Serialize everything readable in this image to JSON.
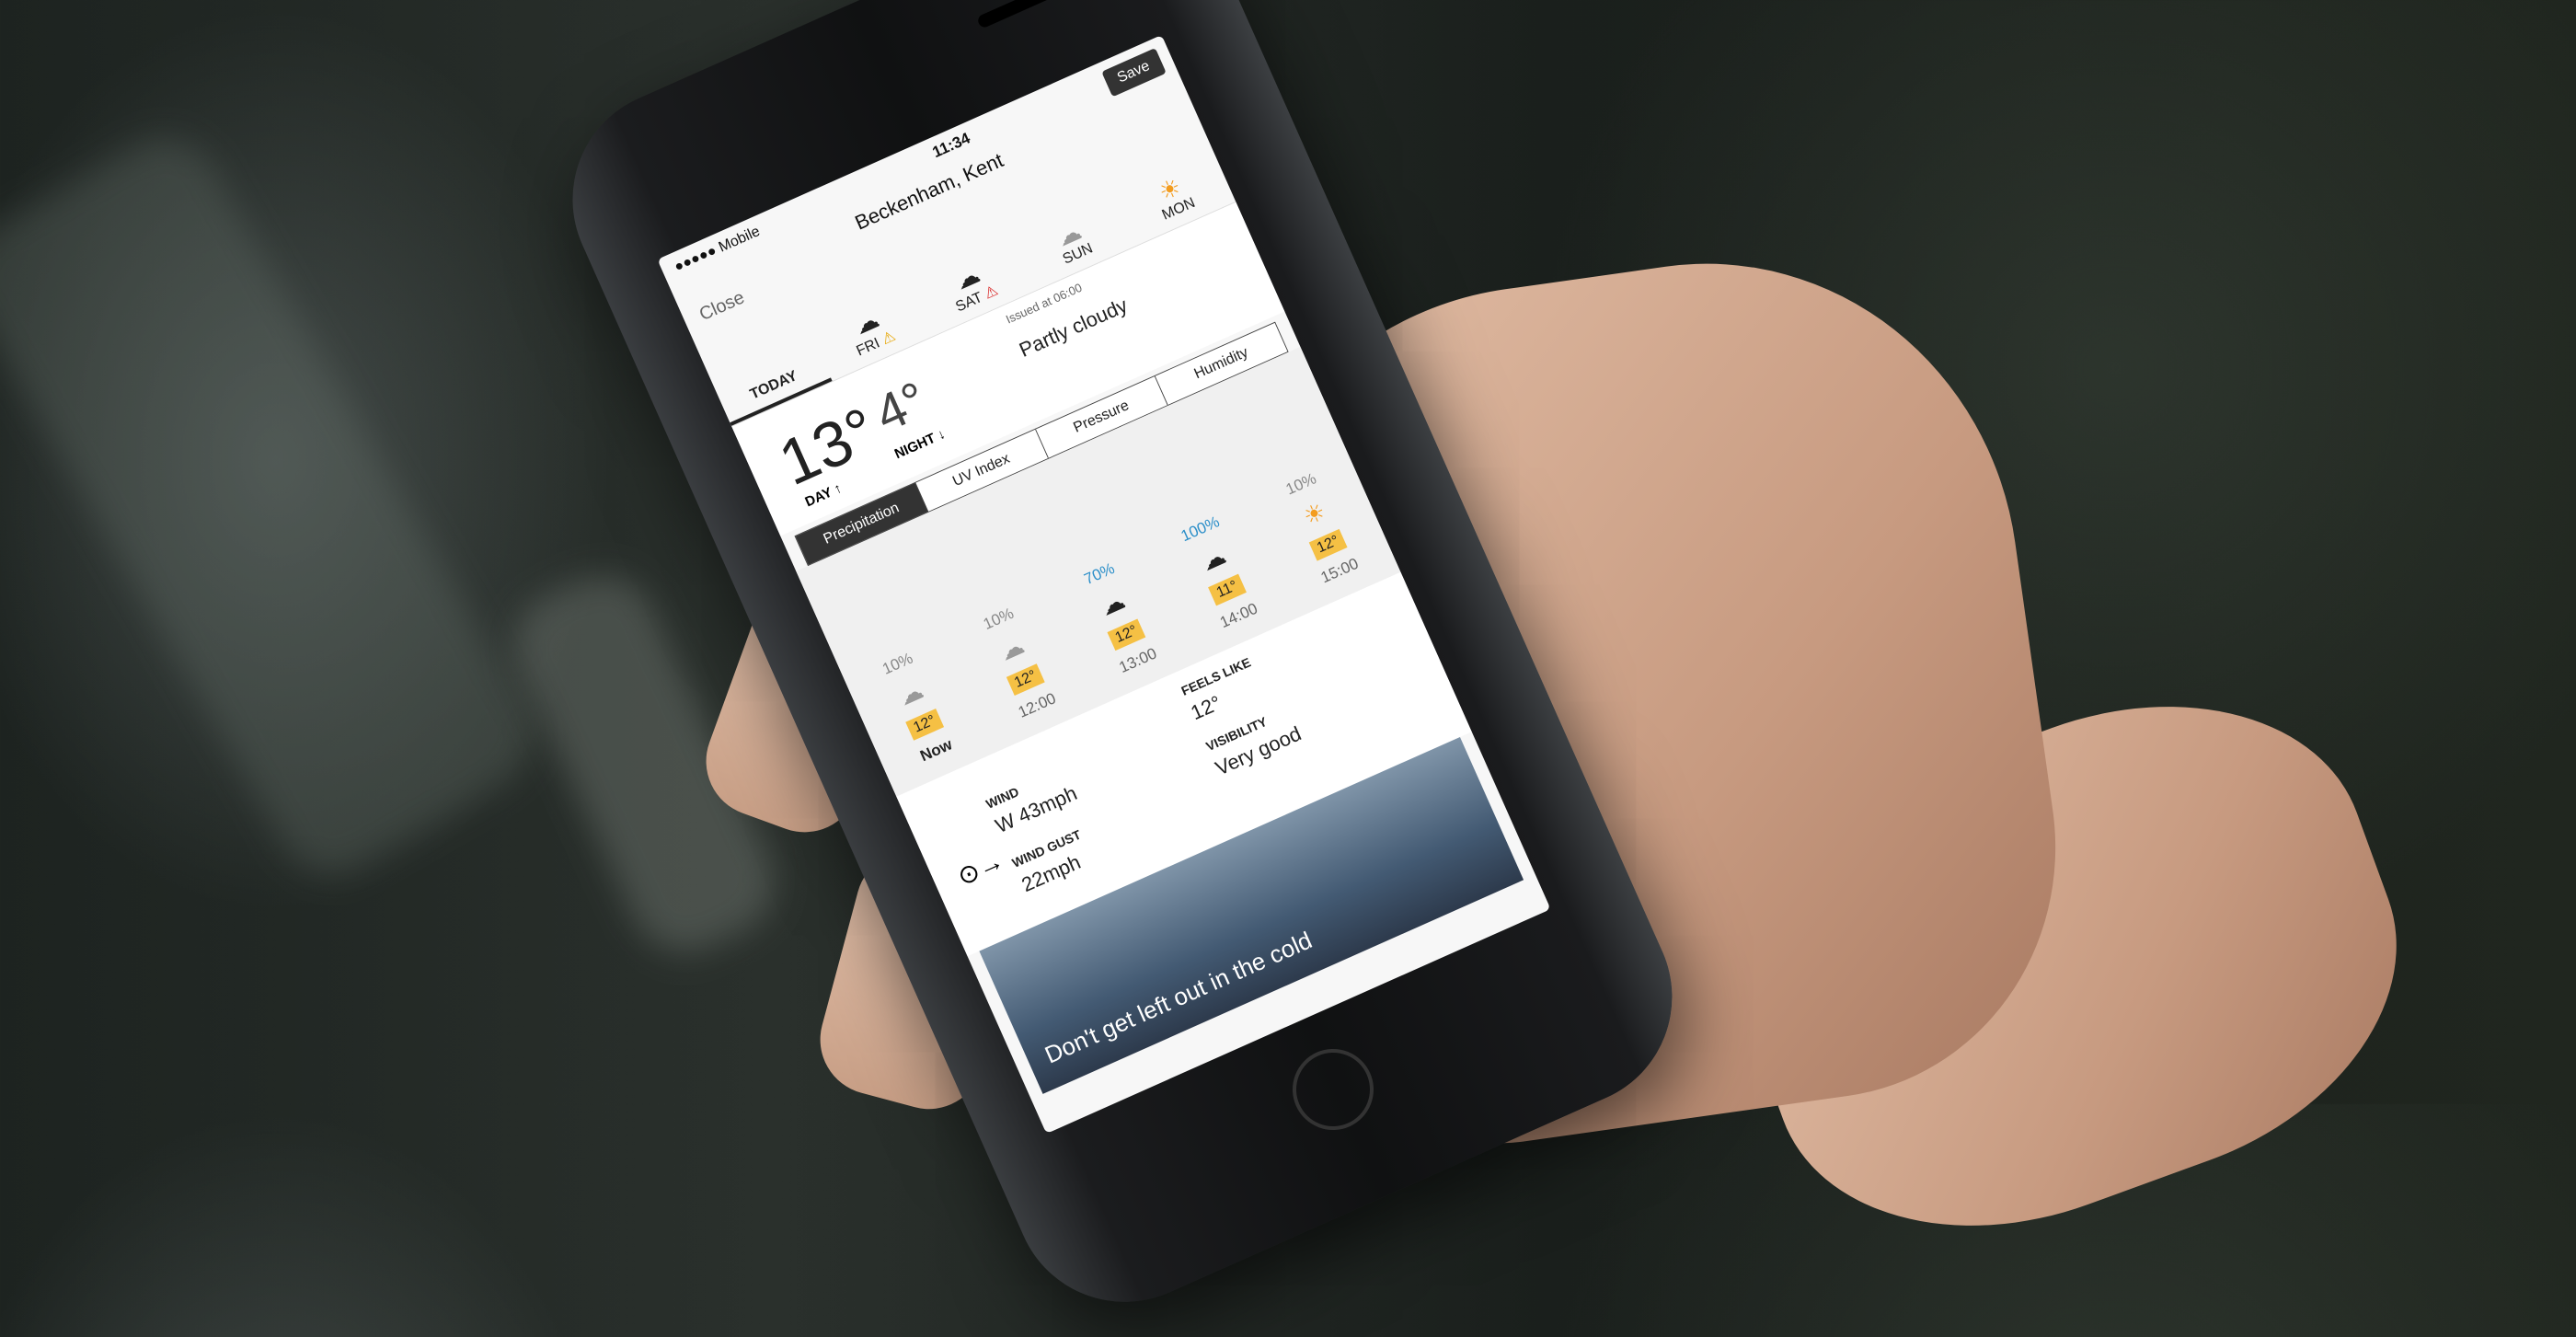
{
  "status_bar": {
    "carrier": "●●●●● Mobile",
    "time": "11:34"
  },
  "header": {
    "close_label": "Close",
    "location": "Beckenham, Kent",
    "save_label": "Save"
  },
  "day_tabs": [
    {
      "label": "TODAY",
      "icon": "",
      "warning": ""
    },
    {
      "label": "FRI",
      "icon": "rain-cloud-icon",
      "warning": "⚠"
    },
    {
      "label": "SAT",
      "icon": "rain-cloud-icon",
      "warning": "⚠"
    },
    {
      "label": "SUN",
      "icon": "cloud-icon",
      "warning": ""
    },
    {
      "label": "MON",
      "icon": "sun-icon",
      "warning": ""
    }
  ],
  "summary": {
    "day_temp": "13°",
    "night_temp": "4°",
    "day_label": "DAY ↑",
    "night_label": "NIGHT ↓",
    "issued": "Issued at 06:00",
    "condition": "Partly cloudy"
  },
  "metric_tabs": [
    "Precipitation",
    "UV Index",
    "Pressure",
    "Humidity"
  ],
  "hourly": [
    {
      "pct": "10%",
      "icon": "cloud-icon",
      "temp": "12°",
      "time": "Now"
    },
    {
      "pct": "10%",
      "icon": "cloud-icon",
      "temp": "12°",
      "time": "12:00"
    },
    {
      "pct": "70%",
      "icon": "rain-cloud-icon",
      "temp": "12°",
      "time": "13:00"
    },
    {
      "pct": "100%",
      "icon": "thunder-cloud-icon",
      "temp": "11°",
      "time": "14:00"
    },
    {
      "pct": "10%",
      "icon": "sun-icon",
      "temp": "12°",
      "time": "15:00"
    }
  ],
  "details": {
    "wind_label": "WIND",
    "wind_value": "W 43mph",
    "gust_label": "WIND GUST",
    "gust_value": "22mph",
    "feels_label": "FEELS LIKE",
    "feels_value": "12°",
    "visibility_label": "VISIBILITY",
    "visibility_value": "Very good"
  },
  "banner": {
    "text": "Don't get left out in the cold"
  }
}
